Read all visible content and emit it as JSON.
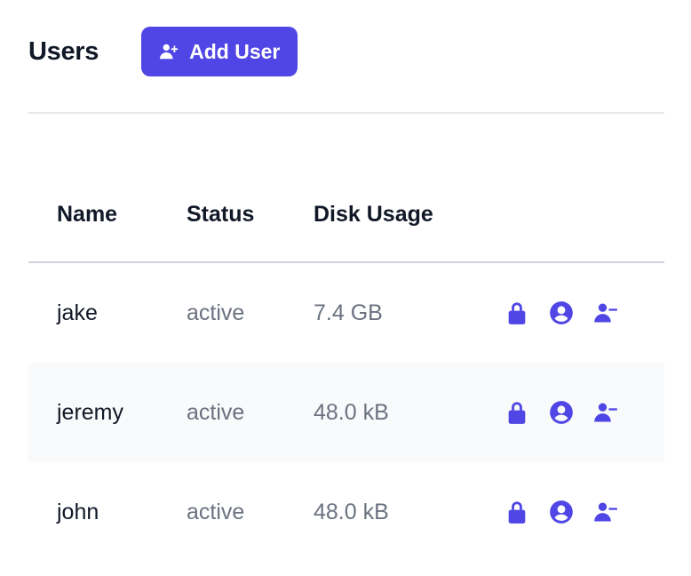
{
  "header": {
    "title": "Users",
    "add_user_label": "Add User"
  },
  "colors": {
    "accent": "#4f46e5",
    "muted_text": "#6b7280",
    "primary_text": "#111827",
    "row_alt_bg": "#f9fafb"
  },
  "table": {
    "columns": [
      "Name",
      "Status",
      "Disk Usage"
    ],
    "rows": [
      {
        "name": "jake",
        "status": "active",
        "disk_usage": "7.4 GB",
        "actions": [
          "lock-icon",
          "user-circle-icon",
          "user-remove-icon"
        ]
      },
      {
        "name": "jeremy",
        "status": "active",
        "disk_usage": "48.0 kB",
        "actions": [
          "lock-icon",
          "user-circle-icon",
          "user-remove-icon"
        ]
      },
      {
        "name": "john",
        "status": "active",
        "disk_usage": "48.0 kB",
        "actions": [
          "lock-icon",
          "user-circle-icon",
          "user-remove-icon"
        ]
      }
    ]
  }
}
